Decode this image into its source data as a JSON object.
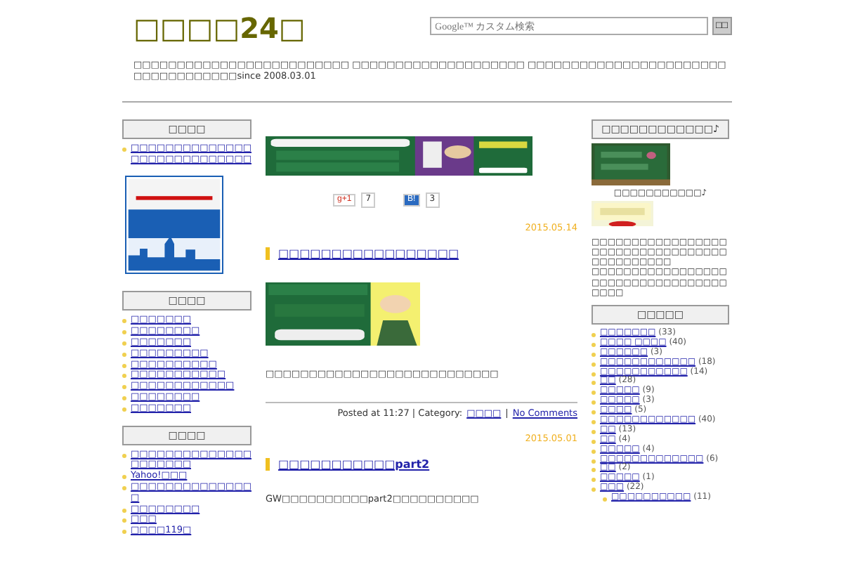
{
  "header": {
    "title": "□□□□24□",
    "search": {
      "placeholder": "Google™ カスタム検索",
      "button": "□□"
    },
    "description": "□□□□□□□□□□□□□□□□□□□□□□□□□ □□□□□□□□□□□□□□□□□□□□ □□□□□□□□□□□□□□□□□□□□□□□□□□□□□□□□□□□since 2008.03.01"
  },
  "left_sidebar": [
    {
      "heading": "□□□□",
      "items": [
        "□□□□□□□□□□□□□□□□□□□□□□□□□□□□"
      ],
      "banner": {
        "kind": "picture"
      }
    },
    {
      "heading": "□□□□",
      "items": [
        "□□□□□□□",
        "□□□□□□□□",
        "□□□□□□□",
        "□□□□□□□□□",
        "□□□□□□□□□□",
        "□□□□□□□□□□□",
        "□□□□□□□□□□□□",
        "□□□□□□□□",
        "□□□□□□□"
      ]
    },
    {
      "heading": "□□□□",
      "items": [
        "□□□□□□□□□□□□□□□□□□□□□",
        "Yahoo!□□□",
        "□□□□□□□□□□□□□□□",
        "□□□□□□□□",
        "□□□",
        "□□□□119□"
      ]
    }
  ],
  "main": {
    "banner": {
      "kind": "picture"
    },
    "share": {
      "gplus": "g+1",
      "gplus_count": "7",
      "hatena": "B!",
      "hatena_count": "3"
    },
    "posts": [
      {
        "date": "2015.05.14",
        "title": "□□□□□□□□□□□□□□□□□",
        "image": {
          "kind": "picture"
        },
        "body": "□□□□□□□□□□□□□□□□□□□□□□□□□□□",
        "meta": {
          "posted": "Posted at 11:27 | Category:",
          "category": "□□□□",
          "separator": "|",
          "comments": "No Comments"
        }
      },
      {
        "date": "2015.05.01",
        "title": "□□□□□□□□□□□part2",
        "body": "GW□□□□□□□□□□part2□□□□□□□□□□"
      }
    ]
  },
  "right_sidebar": {
    "heading": "□□□□□□□□□□□□♪",
    "ranking_image": {
      "kind": "picture"
    },
    "ranking_caption": "□□□□□□□□□□□♪",
    "category_image": {
      "kind": "picture"
    },
    "paragraphs": [
      "□□□□□□□□□□□□□□□□□□□□□□□□□□□□□□□□□□□□□□□□□□□□",
      "□□□□□□□□□□□□□□□□□□□□□□□□□□□□□□□□□□□□□□"
    ],
    "categories_heading": "□□□□□",
    "categories": [
      {
        "name": "□□□□□□□",
        "count": "(33)"
      },
      {
        "name": "□□□□ □□□□",
        "count": "(40)"
      },
      {
        "name": "□□□□□□",
        "count": "(3)"
      },
      {
        "name": "□□□□□□□□□□□□",
        "count": "(18)"
      },
      {
        "name": "□□□□□□□□□□□",
        "count": "(14)"
      },
      {
        "name": "□□",
        "count": "(28)"
      },
      {
        "name": "□□□□□",
        "count": "(9)"
      },
      {
        "name": "□□□□□",
        "count": "(3)"
      },
      {
        "name": "□□□□",
        "count": "(5)"
      },
      {
        "name": "□□□□□□□□□□□□",
        "count": "(40)"
      },
      {
        "name": "□□",
        "count": "(13)"
      },
      {
        "name": "□□",
        "count": "(4)"
      },
      {
        "name": "□□□□□",
        "count": "(4)"
      },
      {
        "name": "□□□□□□□□□□□□□",
        "count": "(6)"
      },
      {
        "name": "□□",
        "count": "(2)"
      },
      {
        "name": "□□□□□",
        "count": "(1)"
      },
      {
        "name": "□□□",
        "count": "(22)",
        "children": [
          {
            "name": "□□□□□□□□□□",
            "count": "(11)"
          }
        ]
      }
    ]
  }
}
